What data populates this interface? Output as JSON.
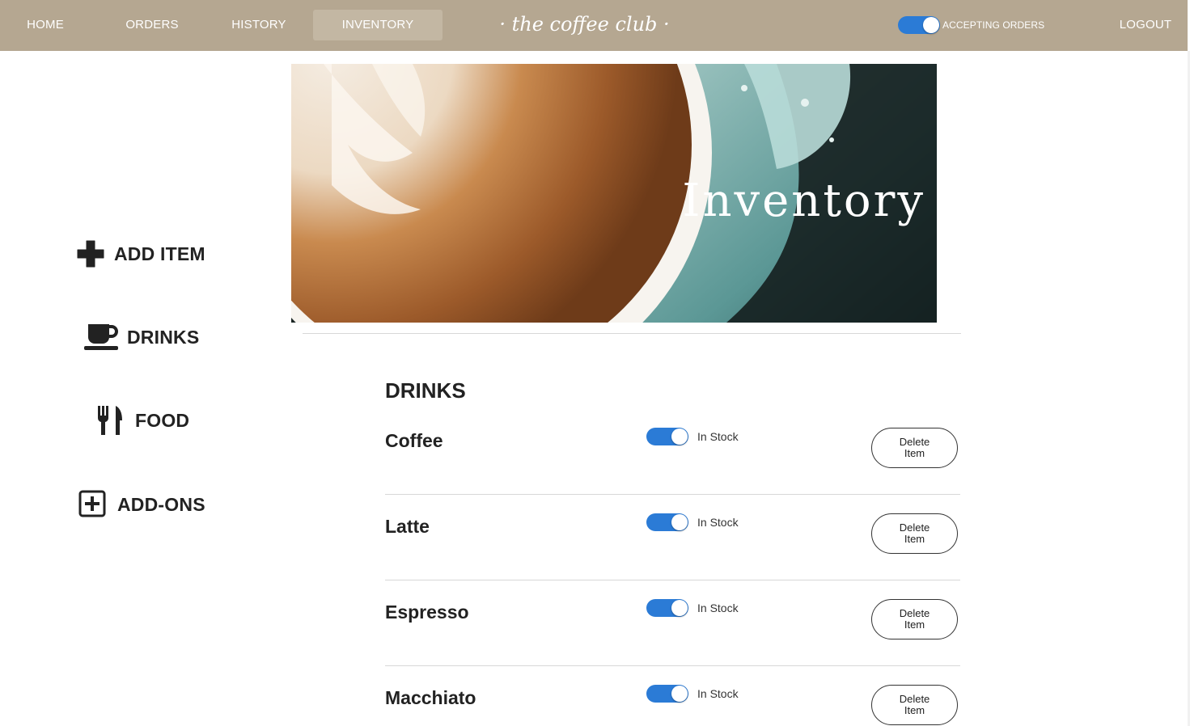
{
  "nav": {
    "items": [
      {
        "label": "HOME",
        "active": false
      },
      {
        "label": "ORDERS",
        "active": false
      },
      {
        "label": "HISTORY",
        "active": false
      },
      {
        "label": "INVENTORY",
        "active": true
      }
    ],
    "brand": "· the coffee club ·",
    "accepting_label": "ACCEPTING ORDERS",
    "accepting_on": true,
    "logout": "LOGOUT"
  },
  "sidebar": {
    "items": [
      {
        "label": "ADD ITEM",
        "icon": "plus-icon"
      },
      {
        "label": "DRINKS",
        "icon": "coffee-cup-icon"
      },
      {
        "label": "FOOD",
        "icon": "fork-knife-icon"
      },
      {
        "label": "ADD-ONS",
        "icon": "plus-square-icon"
      }
    ]
  },
  "hero": {
    "title": "Inventory"
  },
  "section": {
    "title": "DRINKS"
  },
  "items": [
    {
      "name": "Coffee",
      "status": "In Stock",
      "in_stock": true,
      "delete_label": "Delete Item"
    },
    {
      "name": "Latte",
      "status": "In Stock",
      "in_stock": true,
      "delete_label": "Delete Item"
    },
    {
      "name": "Espresso",
      "status": "In Stock",
      "in_stock": true,
      "delete_label": "Delete Item"
    },
    {
      "name": "Macchiato",
      "status": "In Stock",
      "in_stock": true,
      "delete_label": "Delete Item"
    }
  ],
  "colors": {
    "nav_bg": "#b5a791",
    "nav_active": "#c3b7a3",
    "toggle_on": "#2b7bd6",
    "text": "#222222"
  }
}
